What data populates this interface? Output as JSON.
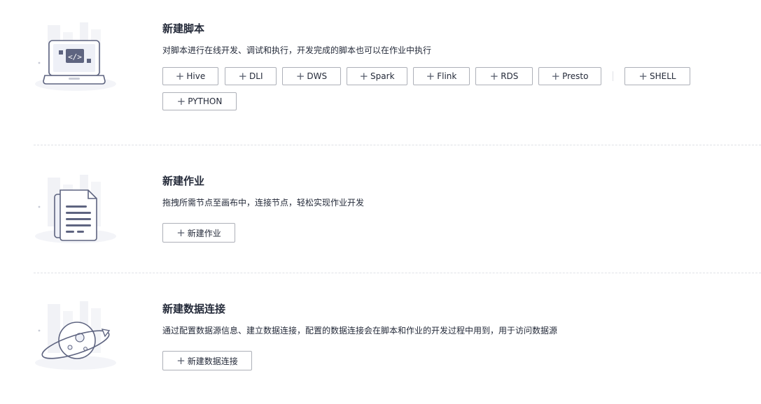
{
  "sections": [
    {
      "title": "新建脚本",
      "desc": "对脚本进行在线开发、调试和执行，开发完成的脚本也可以在作业中执行",
      "illustration_icon": "laptop-code-icon",
      "buttons": [
        {
          "label": "Hive"
        },
        {
          "label": "DLI"
        },
        {
          "label": "DWS"
        },
        {
          "label": "Spark"
        },
        {
          "label": "Flink"
        },
        {
          "label": "RDS"
        },
        {
          "label": "Presto"
        },
        {
          "label": "SHELL"
        },
        {
          "label": "PYTHON"
        }
      ]
    },
    {
      "title": "新建作业",
      "desc": "拖拽所需节点至画布中，连接节点，轻松实现作业开发",
      "illustration_icon": "document-icon",
      "buttons": [
        {
          "label": "新建作业"
        }
      ]
    },
    {
      "title": "新建数据连接",
      "desc": "通过配置数据源信息、建立数据连接，配置的数据连接会在脚本和作业的开发过程中用到，用于访问数据源",
      "illustration_icon": "planet-icon",
      "buttons": [
        {
          "label": "新建数据连接"
        }
      ]
    }
  ],
  "icons": {
    "plus": "+",
    "plus_icon_name": "plus-icon"
  },
  "colors": {
    "text": "#252b3a",
    "border": "#adb0b8",
    "illustration": "#5e6480",
    "illustration_light": "#eef0f6"
  }
}
